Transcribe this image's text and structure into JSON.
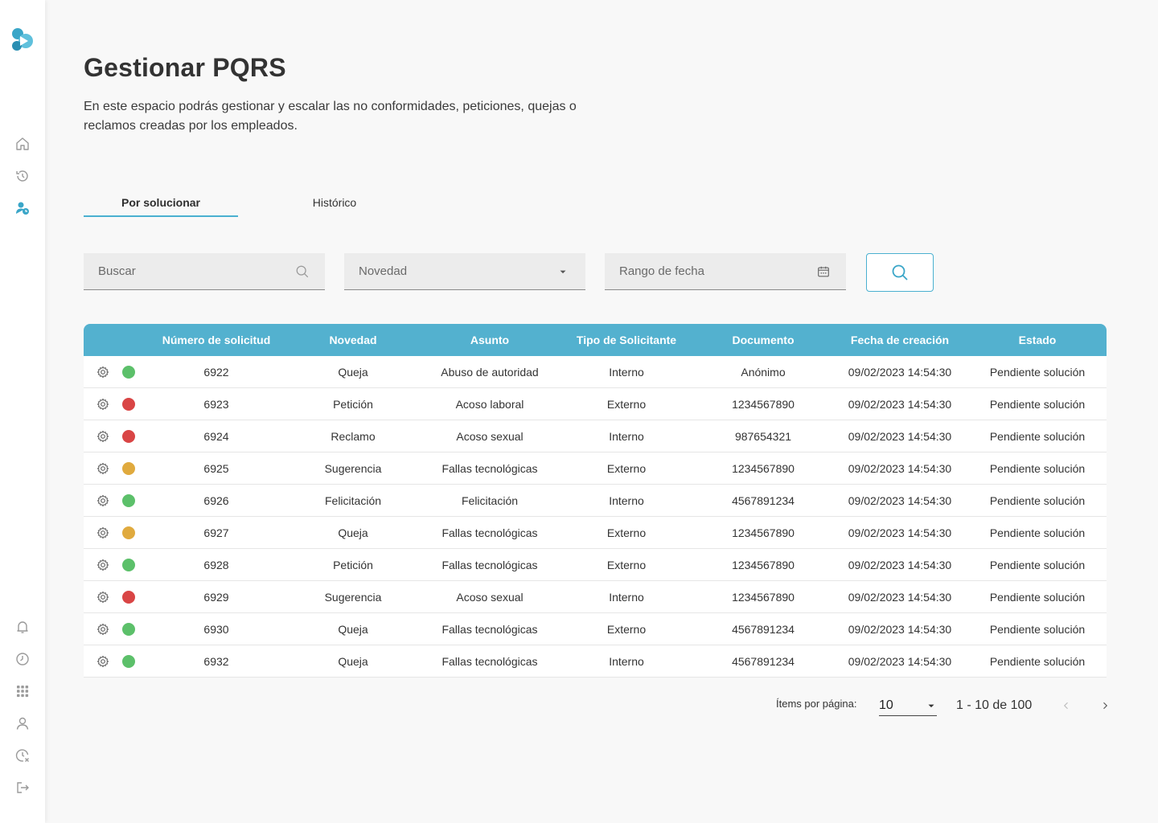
{
  "page": {
    "title": "Gestionar PQRS",
    "subtitle": "En este espacio podrás gestionar y escalar las no conformidades, peticiones, quejas o reclamos creadas por los empleados."
  },
  "sidebar": {
    "logo": "app-logo",
    "top_items": [
      "home-icon",
      "history-icon",
      "user-clock-icon"
    ],
    "bottom_items": [
      "bell-icon",
      "clock-icon",
      "grid-icon",
      "user-icon",
      "clock-cancel-icon",
      "logout-icon"
    ],
    "accent": "#3aa6c8"
  },
  "tabs": [
    {
      "label": "Por solucionar",
      "active": true
    },
    {
      "label": "Histórico",
      "active": false
    }
  ],
  "filters": {
    "search_placeholder": "Buscar",
    "novedad_placeholder": "Novedad",
    "date_placeholder": "Rango de fecha"
  },
  "table": {
    "headers": [
      "Número de solicitud",
      "Novedad",
      "Asunto",
      "Tipo de Solicitante",
      "Documento",
      "Fecha de creación",
      "Estado"
    ],
    "rows": [
      {
        "status": "green",
        "num": "6922",
        "novedad": "Queja",
        "asunto": "Abuso de autoridad",
        "tipo": "Interno",
        "documento": "Anónimo",
        "fecha": "09/02/2023 14:54:30",
        "estado": "Pendiente solución"
      },
      {
        "status": "red",
        "num": "6923",
        "novedad": "Petición",
        "asunto": "Acoso laboral",
        "tipo": "Externo",
        "documento": "1234567890",
        "fecha": "09/02/2023 14:54:30",
        "estado": "Pendiente solución"
      },
      {
        "status": "red",
        "num": "6924",
        "novedad": "Reclamo",
        "asunto": "Acoso sexual",
        "tipo": "Interno",
        "documento": "987654321",
        "fecha": "09/02/2023 14:54:30",
        "estado": "Pendiente solución"
      },
      {
        "status": "yellow",
        "num": "6925",
        "novedad": "Sugerencia",
        "asunto": "Fallas tecnológicas",
        "tipo": "Externo",
        "documento": "1234567890",
        "fecha": "09/02/2023 14:54:30",
        "estado": "Pendiente solución"
      },
      {
        "status": "green",
        "num": "6926",
        "novedad": "Felicitación",
        "asunto": "Felicitación",
        "tipo": "Interno",
        "documento": "4567891234",
        "fecha": "09/02/2023 14:54:30",
        "estado": "Pendiente solución"
      },
      {
        "status": "yellow",
        "num": "6927",
        "novedad": "Queja",
        "asunto": "Fallas tecnológicas",
        "tipo": "Externo",
        "documento": "1234567890",
        "fecha": "09/02/2023 14:54:30",
        "estado": "Pendiente solución"
      },
      {
        "status": "green",
        "num": "6928",
        "novedad": "Petición",
        "asunto": "Fallas tecnológicas",
        "tipo": "Externo",
        "documento": "1234567890",
        "fecha": "09/02/2023 14:54:30",
        "estado": "Pendiente solución"
      },
      {
        "status": "red",
        "num": "6929",
        "novedad": "Sugerencia",
        "asunto": "Acoso sexual",
        "tipo": "Interno",
        "documento": "1234567890",
        "fecha": "09/02/2023 14:54:30",
        "estado": "Pendiente solución"
      },
      {
        "status": "green",
        "num": "6930",
        "novedad": "Queja",
        "asunto": "Fallas tecnológicas",
        "tipo": "Externo",
        "documento": "4567891234",
        "fecha": "09/02/2023 14:54:30",
        "estado": "Pendiente solución"
      },
      {
        "status": "green",
        "num": "6932",
        "novedad": "Queja",
        "asunto": "Fallas tecnológicas",
        "tipo": "Interno",
        "documento": "4567891234",
        "fecha": "09/02/2023 14:54:30",
        "estado": "Pendiente solución"
      }
    ]
  },
  "status_colors": {
    "green": "#5cc06a",
    "red": "#d94545",
    "yellow": "#e0aa3e"
  },
  "header_color": "#53b1cf",
  "pagination": {
    "items_label": "Ítems por página:",
    "page_size": "10",
    "range": "1 - 10 de 100"
  }
}
